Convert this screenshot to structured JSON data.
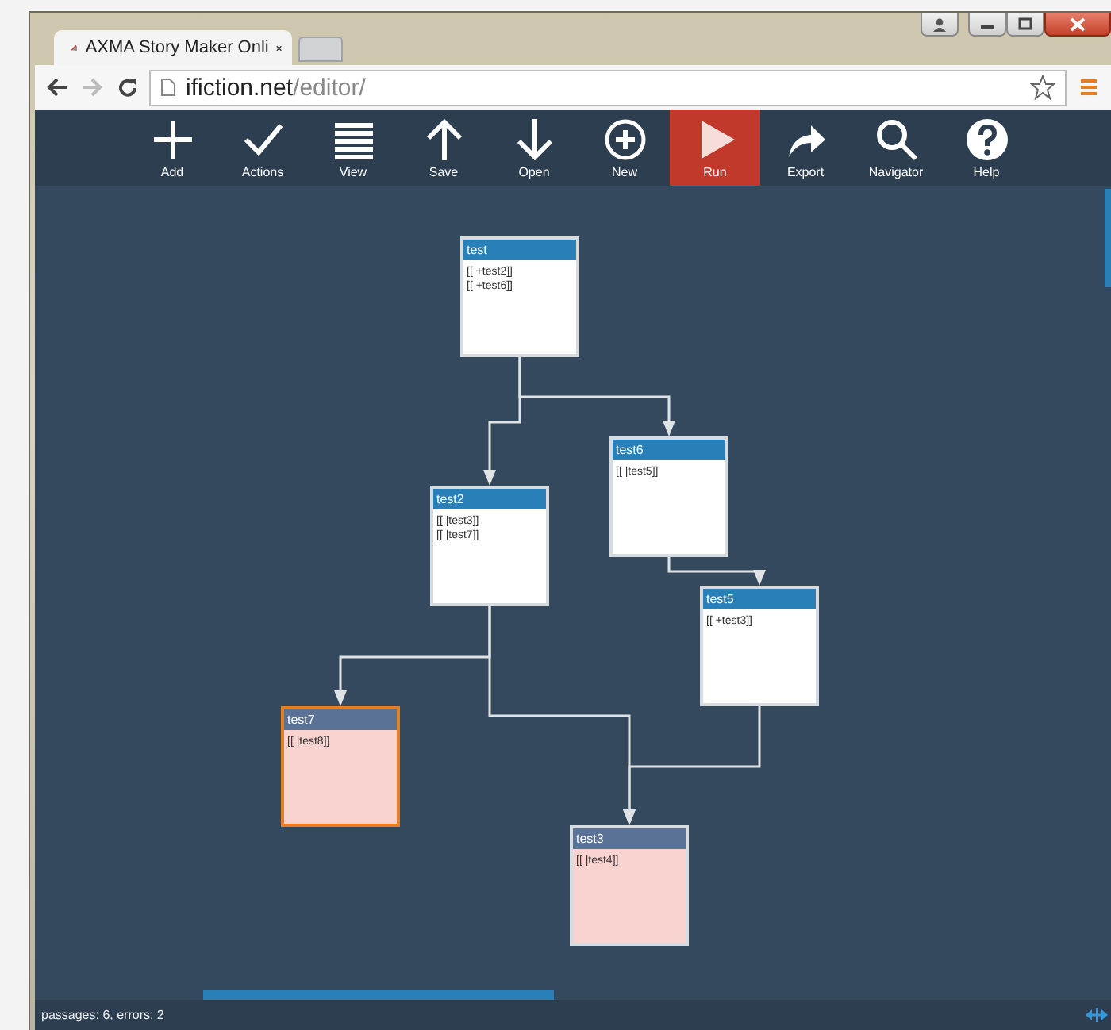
{
  "browser": {
    "tab_title": "AXMA Story Maker Onli",
    "address": {
      "host": "ifiction.net",
      "path": "/editor/"
    }
  },
  "toolbar": [
    {
      "kind": "add",
      "label": "Add",
      "active": false
    },
    {
      "kind": "actions",
      "label": "Actions",
      "active": false
    },
    {
      "kind": "view",
      "label": "View",
      "active": false
    },
    {
      "kind": "save",
      "label": "Save",
      "active": false
    },
    {
      "kind": "open",
      "label": "Open",
      "active": false
    },
    {
      "kind": "new",
      "label": "New",
      "active": false
    },
    {
      "kind": "run",
      "label": "Run",
      "active": true
    },
    {
      "kind": "export",
      "label": "Export",
      "active": false
    },
    {
      "kind": "navigator",
      "label": "Navigator",
      "active": false
    },
    {
      "kind": "help",
      "label": "Help",
      "active": false
    }
  ],
  "passages": [
    {
      "title": "test",
      "links": [
        "[[ +test2]]",
        "[[ +test6]]"
      ],
      "broken": false,
      "selected": false
    },
    {
      "title": "test6",
      "links": [
        "[[ |test5]]"
      ],
      "broken": false,
      "selected": false
    },
    {
      "title": "test2",
      "links": [
        "[[ |test3]]",
        "[[ |test7]]"
      ],
      "broken": false,
      "selected": false
    },
    {
      "title": "test5",
      "links": [
        "[[ +test3]]"
      ],
      "broken": false,
      "selected": false
    },
    {
      "title": "test7",
      "links": [
        "[[ |test8]]"
      ],
      "broken": true,
      "selected": true
    },
    {
      "title": "test3",
      "links": [
        "[[ |test4]]"
      ],
      "broken": true,
      "selected": false
    }
  ],
  "status_bar": {
    "text": "passages: 6, errors: 2"
  }
}
